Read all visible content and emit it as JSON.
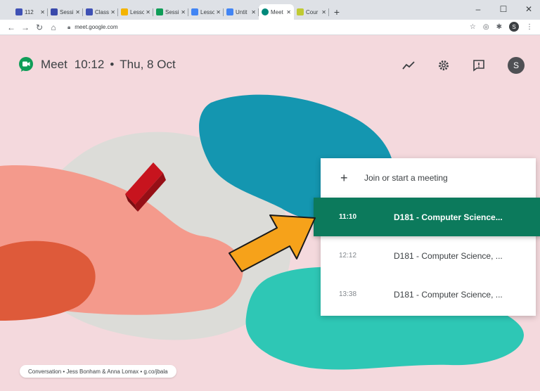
{
  "browser": {
    "tabs": [
      {
        "label": "112",
        "color": "#3f51b5"
      },
      {
        "label": "Sessi",
        "color": "#3949ab"
      },
      {
        "label": "Class",
        "color": "#3f51b5"
      },
      {
        "label": "Lesso",
        "color": "#f4b400"
      },
      {
        "label": "Sessi",
        "color": "#0f9d58"
      },
      {
        "label": "Lesso",
        "color": "#4285f4"
      },
      {
        "label": "Untit",
        "color": "#4285f4"
      },
      {
        "label": "Meet",
        "color": "#00897b",
        "active": true
      },
      {
        "label": "Cour",
        "color": "#c0ca33"
      }
    ],
    "address": "meet.google.com",
    "profile_initial": "S"
  },
  "appbar": {
    "title": "Meet",
    "time": "10:12",
    "separator": "•",
    "date": "Thu, 8 Oct",
    "avatar_initial": "S"
  },
  "card": {
    "join_label": "Join or start a meeting",
    "meetings": [
      {
        "time": "11:10",
        "title": "D181 - Computer Science...",
        "highlighted": true
      },
      {
        "time": "12:12",
        "title": "D181 - Computer Science, ..."
      },
      {
        "time": "13:38",
        "title": "D181 - Computer Science, ..."
      }
    ]
  },
  "credit": "Conversation • Jess Bonham & Anna Lomax • g.co/jbala",
  "colors": {
    "background": "#f4d9dd",
    "highlight": "#0c7a5c",
    "arrow": "#f6a21a",
    "teal_shape": "#1496b0",
    "mint_shape": "#2ec7b5",
    "salmon_shape": "#f49a8c"
  }
}
